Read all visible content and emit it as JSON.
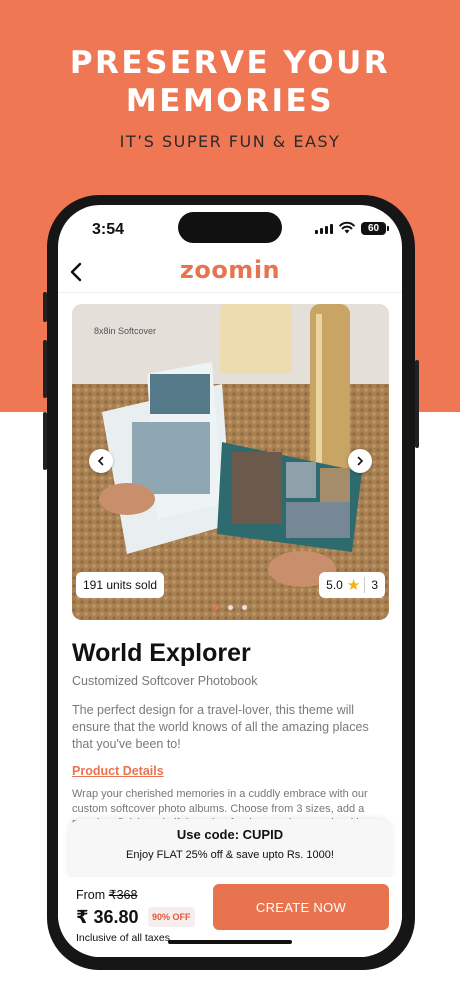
{
  "promo_header": {
    "headline_line1": "PRESERVE YOUR",
    "headline_line2": "MEMORIES",
    "subline": "IT’S SUPER FUN & EASY"
  },
  "status_bar": {
    "time": "3:54",
    "battery": "60",
    "icons": [
      "signal-icon",
      "wifi-icon",
      "battery-icon"
    ]
  },
  "nav": {
    "back_icon": "chevron-left-icon",
    "logo": "zoomin"
  },
  "product_image": {
    "tag": "8x8in Softcover",
    "units_sold": "191 units sold",
    "rating": "5.0",
    "review_count": "3",
    "carousel_dots": 3,
    "active_dot": 1
  },
  "product": {
    "title": "World Explorer",
    "subtitle": "Customized Softcover Photobook",
    "description": "The perfect design for a travel-lover, this theme will ensure that the world knows of all the amazing places that you've been to!",
    "details_link": "Product Details",
    "details_text": "Wrap your cherished memories in a cuddly embrace with our custom softcover photo albums. Choose from 3 sizes, add a premium finish and gift it so that fond memories remain with you forever."
  },
  "promo": {
    "code_line": "Use code: CUPID",
    "offer_line": "Enjoy FLAT 25% off & save upto Rs. 1000!"
  },
  "footer": {
    "from_label": "From",
    "original_price": "₹368",
    "price": "₹ 36.80",
    "discount": "90% OFF",
    "taxes": "Inclusive of all taxes",
    "cta": "CREATE NOW"
  },
  "colors": {
    "brand": "#e8734f",
    "header_bg": "#ef7754"
  }
}
